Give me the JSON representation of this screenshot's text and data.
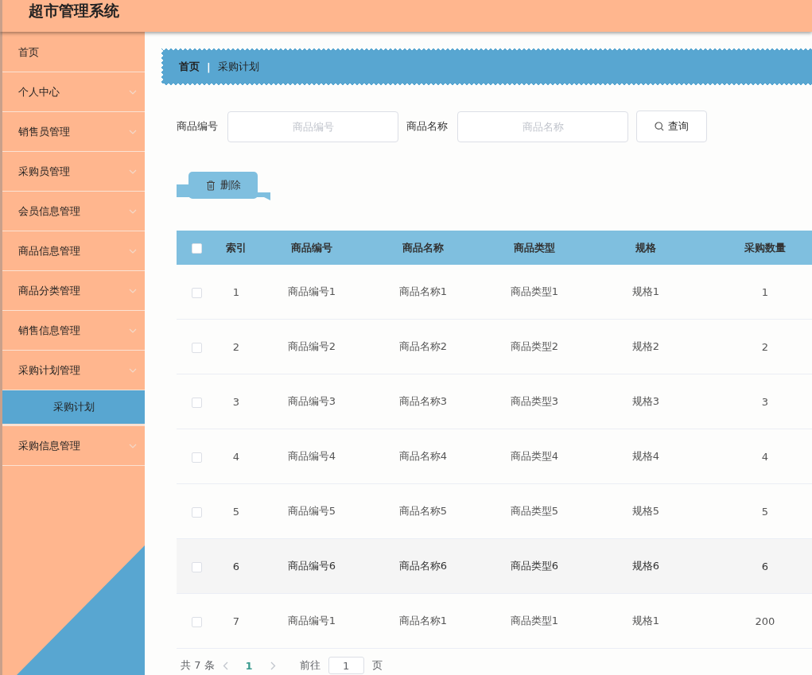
{
  "header": {
    "title": "超市管理系统"
  },
  "sidebar": {
    "items": [
      {
        "label": "首页",
        "kind": "link"
      },
      {
        "label": "个人中心",
        "kind": "menu"
      },
      {
        "label": "销售员管理",
        "kind": "menu"
      },
      {
        "label": "采购员管理",
        "kind": "menu"
      },
      {
        "label": "会员信息管理",
        "kind": "menu"
      },
      {
        "label": "商品信息管理",
        "kind": "menu"
      },
      {
        "label": "商品分类管理",
        "kind": "menu"
      },
      {
        "label": "销售信息管理",
        "kind": "menu"
      },
      {
        "label": "采购计划管理",
        "kind": "menu",
        "children": [
          {
            "label": "采购计划",
            "selected": true
          }
        ]
      },
      {
        "label": "采购信息管理",
        "kind": "menu"
      }
    ]
  },
  "breadcrumb": {
    "items": [
      "首页",
      "采购计划"
    ],
    "separator": "|"
  },
  "search": {
    "fields": [
      {
        "label": "商品编号",
        "placeholder": "商品编号"
      },
      {
        "label": "商品名称",
        "placeholder": "商品名称"
      }
    ],
    "button": "查询"
  },
  "actions": {
    "delete": "删除"
  },
  "table": {
    "select_all_checked": false,
    "columns": [
      "索引",
      "商品编号",
      "商品名称",
      "商品类型",
      "规格",
      "采购数量"
    ],
    "rows": [
      {
        "cells": [
          "1",
          "商品编号1",
          "商品名称1",
          "商品类型1",
          "规格1",
          "1"
        ],
        "checked": false,
        "hovered": false
      },
      {
        "cells": [
          "2",
          "商品编号2",
          "商品名称2",
          "商品类型2",
          "规格2",
          "2"
        ],
        "checked": false,
        "hovered": false
      },
      {
        "cells": [
          "3",
          "商品编号3",
          "商品名称3",
          "商品类型3",
          "规格3",
          "3"
        ],
        "checked": false,
        "hovered": false
      },
      {
        "cells": [
          "4",
          "商品编号4",
          "商品名称4",
          "商品类型4",
          "规格4",
          "4"
        ],
        "checked": false,
        "hovered": false
      },
      {
        "cells": [
          "5",
          "商品编号5",
          "商品名称5",
          "商品类型5",
          "规格5",
          "5"
        ],
        "checked": false,
        "hovered": false
      },
      {
        "cells": [
          "6",
          "商品编号6",
          "商品名称6",
          "商品类型6",
          "规格6",
          "6"
        ],
        "checked": false,
        "hovered": true
      },
      {
        "cells": [
          "7",
          "商品编号1",
          "商品名称1",
          "商品类型1",
          "规格1",
          "200"
        ],
        "checked": false,
        "hovered": false
      }
    ]
  },
  "pagination": {
    "total": "共 7 条",
    "pages": [
      {
        "label": "1",
        "selected": true
      }
    ],
    "goto_label": "前往",
    "goto_value": "1",
    "page_unit": "页"
  }
}
